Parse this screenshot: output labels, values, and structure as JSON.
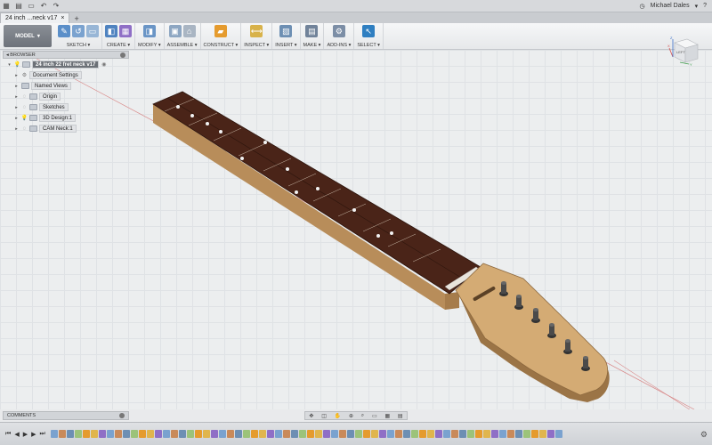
{
  "titlebar": {
    "grid_icon": "apps-grid-icon",
    "user_name": "Michael Dales",
    "user_caret": "▾"
  },
  "tab": {
    "title": "24 inch ...neck v17",
    "close": "×",
    "add": "+"
  },
  "toolbar": {
    "workspace": "MODEL",
    "groups": [
      "SKETCH ▾",
      "CREATE ▾",
      "MODIFY ▾",
      "ASSEMBLE ▾",
      "CONSTRUCT ▾",
      "INSPECT ▾",
      "INSERT ▾",
      "MAKE ▾",
      "ADD-INS ▾",
      "SELECT ▾"
    ]
  },
  "browser": {
    "header": "BROWSER",
    "root": "24 inch 22 fret neck v17",
    "items": [
      "Document Settings",
      "Named Views",
      "Origin",
      "Sketches",
      "3D Design:1",
      "CAM Neck:1"
    ]
  },
  "viewcube": {
    "face": "LEFT",
    "x": "X",
    "y": "Y",
    "z": "Z"
  },
  "comments": {
    "label": "COMMENTS"
  },
  "colors": {
    "accent": "#2f7fc1",
    "fretboard": "#4a2418",
    "maple": "#c9a06a"
  }
}
